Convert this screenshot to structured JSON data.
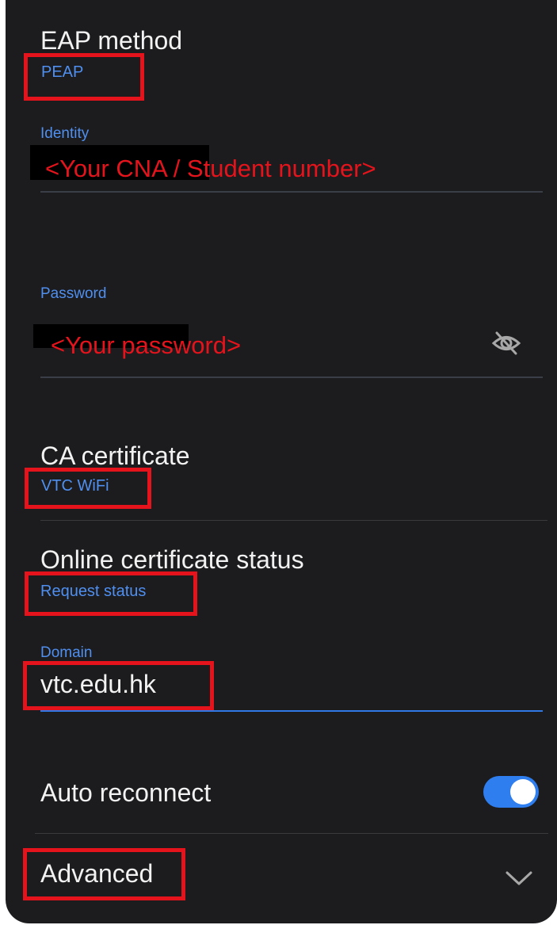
{
  "eap": {
    "title": "EAP method",
    "value": "PEAP"
  },
  "identity": {
    "label": "Identity",
    "placeholder": "<Your CNA / Student number>"
  },
  "password": {
    "label": "Password",
    "placeholder": "<Your password>"
  },
  "ca": {
    "title": "CA certificate",
    "value": "VTC WiFi"
  },
  "ocsp": {
    "title": "Online certificate status",
    "value": "Request status"
  },
  "domain": {
    "label": "Domain",
    "value": "vtc.edu.hk"
  },
  "auto_reconnect": {
    "label": "Auto reconnect",
    "enabled": true
  },
  "advanced": {
    "label": "Advanced"
  },
  "colors": {
    "background": "#1c1c1e",
    "accent": "#4f8ff0",
    "highlight": "#e5141c"
  },
  "icons": {
    "password_visibility": "eye-off-icon",
    "advanced_expand": "chevron-down-icon"
  }
}
